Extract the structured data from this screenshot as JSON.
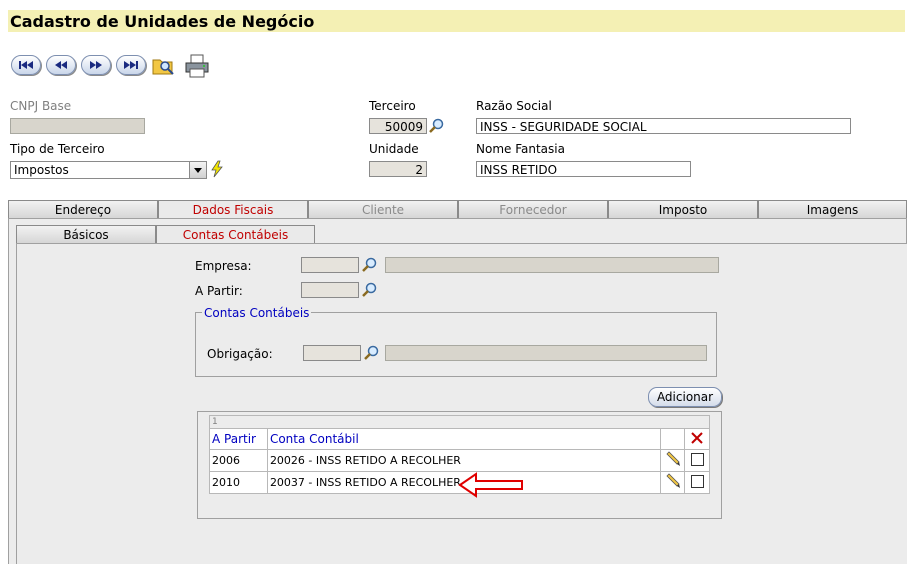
{
  "page": {
    "title": "Cadastro de Unidades de Negócio"
  },
  "toolbar": {
    "buttons": [
      "first-icon",
      "previous-icon",
      "next-icon",
      "last-icon",
      "search-folder-icon",
      "printer-icon"
    ]
  },
  "form": {
    "cnpj_label": "CNPJ Base",
    "cnpj_value": "",
    "terceiro_label": "Terceiro",
    "terceiro_value": "50009",
    "razao_label": "Razão Social",
    "razao_value": "INSS - SEGURIDADE SOCIAL",
    "tipo_label": "Tipo de Terceiro",
    "tipo_value": "Impostos",
    "unidade_label": "Unidade",
    "unidade_value": "2",
    "fantasia_label": "Nome Fantasia",
    "fantasia_value": "INSS RETIDO"
  },
  "tabs": [
    "Endereço",
    "Dados Fiscais",
    "Cliente",
    "Fornecedor",
    "Imposto",
    "Imagens"
  ],
  "subtabs": [
    "Básicos",
    "Contas Contábeis"
  ],
  "contas": {
    "empresa_label": "Empresa:",
    "apartir_label": "A Partir:",
    "group_label": "Contas Contábeis",
    "obrigacao_label": "Obrigação:",
    "add_button": "Adicionar"
  },
  "grid": {
    "count": "1",
    "col_apartir": "A Partir",
    "col_conta": "Conta Contábil",
    "rows": [
      {
        "apartir": "2006",
        "conta": "20026 - INSS RETIDO A RECOLHER"
      },
      {
        "apartir": "2010",
        "conta": "20037 - INSS RETIDO A RECOLHER"
      }
    ]
  },
  "colors": {
    "title_bg": "#f4f0b4",
    "active_tab": "#c00000",
    "header_text": "#0000c0",
    "arrow": "#e00000"
  }
}
